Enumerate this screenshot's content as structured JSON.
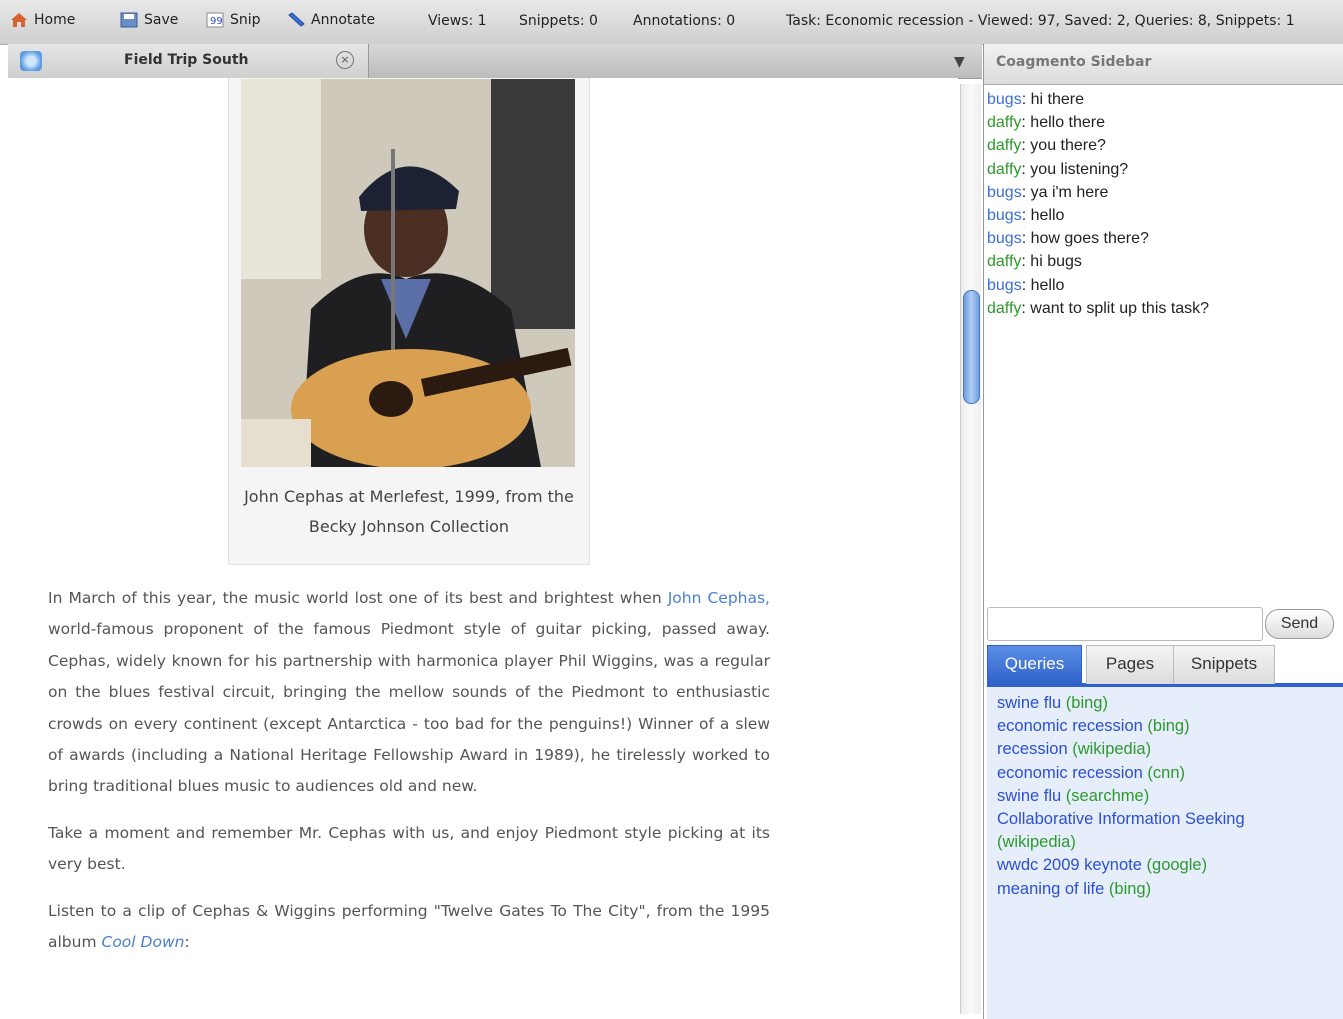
{
  "toolbar": {
    "home": "Home",
    "save": "Save",
    "snip": "Snip",
    "annotate": "Annotate",
    "views": "Views: 1",
    "snippets": "Snippets: 0",
    "annotations": "Annotations: 0",
    "task": "Task: Economic recession - Viewed: 97, Saved: 2, Queries: 8, Snippets: 1"
  },
  "tab": {
    "title": "Field Trip South",
    "close": "×"
  },
  "figure": {
    "caption_line1": "John Cephas at Merlefest, 1999, from the",
    "caption_line2": "Becky Johnson Collection"
  },
  "article": {
    "p1_start": "In March of this year, the music world lost one of its best and brightest when ",
    "p1_link": "John Cephas,",
    "p1_end": " world-famous proponent of the famous Piedmont style of guitar picking, passed away.  Cephas, widely known for his partnership with harmonica player Phil Wiggins, was a regular on the blues festival circuit, bringing the mellow sounds of the Piedmont to enthusiastic crowds on every continent (except Antarctica - too bad for the penguins!) Winner of a slew of awards (including a National Heritage Fellowship Award in 1989), he tirelessly worked to bring traditional blues music to audiences old and new.",
    "p2": "Take a moment and remember Mr. Cephas with us, and enjoy Piedmont style picking at its very best.",
    "p3_start": "Listen to a clip of Cephas & Wiggins performing \"Twelve Gates To The City\", from the 1995 album ",
    "p3_album": "Cool Down",
    "p3_end": ":"
  },
  "sidebar": {
    "title": "Coagmento Sidebar",
    "chat": [
      {
        "user": "bugs",
        "text": ": hi there"
      },
      {
        "user": "daffy",
        "text": ": hello there"
      },
      {
        "user": "daffy",
        "text": ": you there?"
      },
      {
        "user": "daffy",
        "text": ": you listening?"
      },
      {
        "user": "bugs",
        "text": ": ya i'm here"
      },
      {
        "user": "bugs",
        "text": ": hello"
      },
      {
        "user": "bugs",
        "text": ": how goes there?"
      },
      {
        "user": "daffy",
        "text": ": hi bugs"
      },
      {
        "user": "bugs",
        "text": ": hello"
      },
      {
        "user": "daffy",
        "text": ": want to split up this task?"
      }
    ],
    "send": "Send",
    "tabs": [
      "Queries",
      "Pages",
      "Snippets"
    ],
    "queries": [
      {
        "term": "swine flu",
        "source": " (bing)"
      },
      {
        "term": "economic recession",
        "source": " (bing)"
      },
      {
        "term": "recession",
        "source": " (wikipedia)"
      },
      {
        "term": "economic recession",
        "source": " (cnn)"
      },
      {
        "term": "swine flu",
        "source": " (searchme)"
      },
      {
        "term": "Collaborative Information Seeking",
        "source": " (wikipedia)"
      },
      {
        "term": "wwdc 2009 keynote",
        "source": " (google)"
      },
      {
        "term": "meaning of life",
        "source": " (bing)"
      }
    ]
  },
  "icons": {
    "home": "home-icon",
    "save": "save-icon",
    "snip": "snip-icon",
    "annotate": "annotate-icon",
    "tab_close": "close-icon",
    "favicon": "globe-icon"
  }
}
